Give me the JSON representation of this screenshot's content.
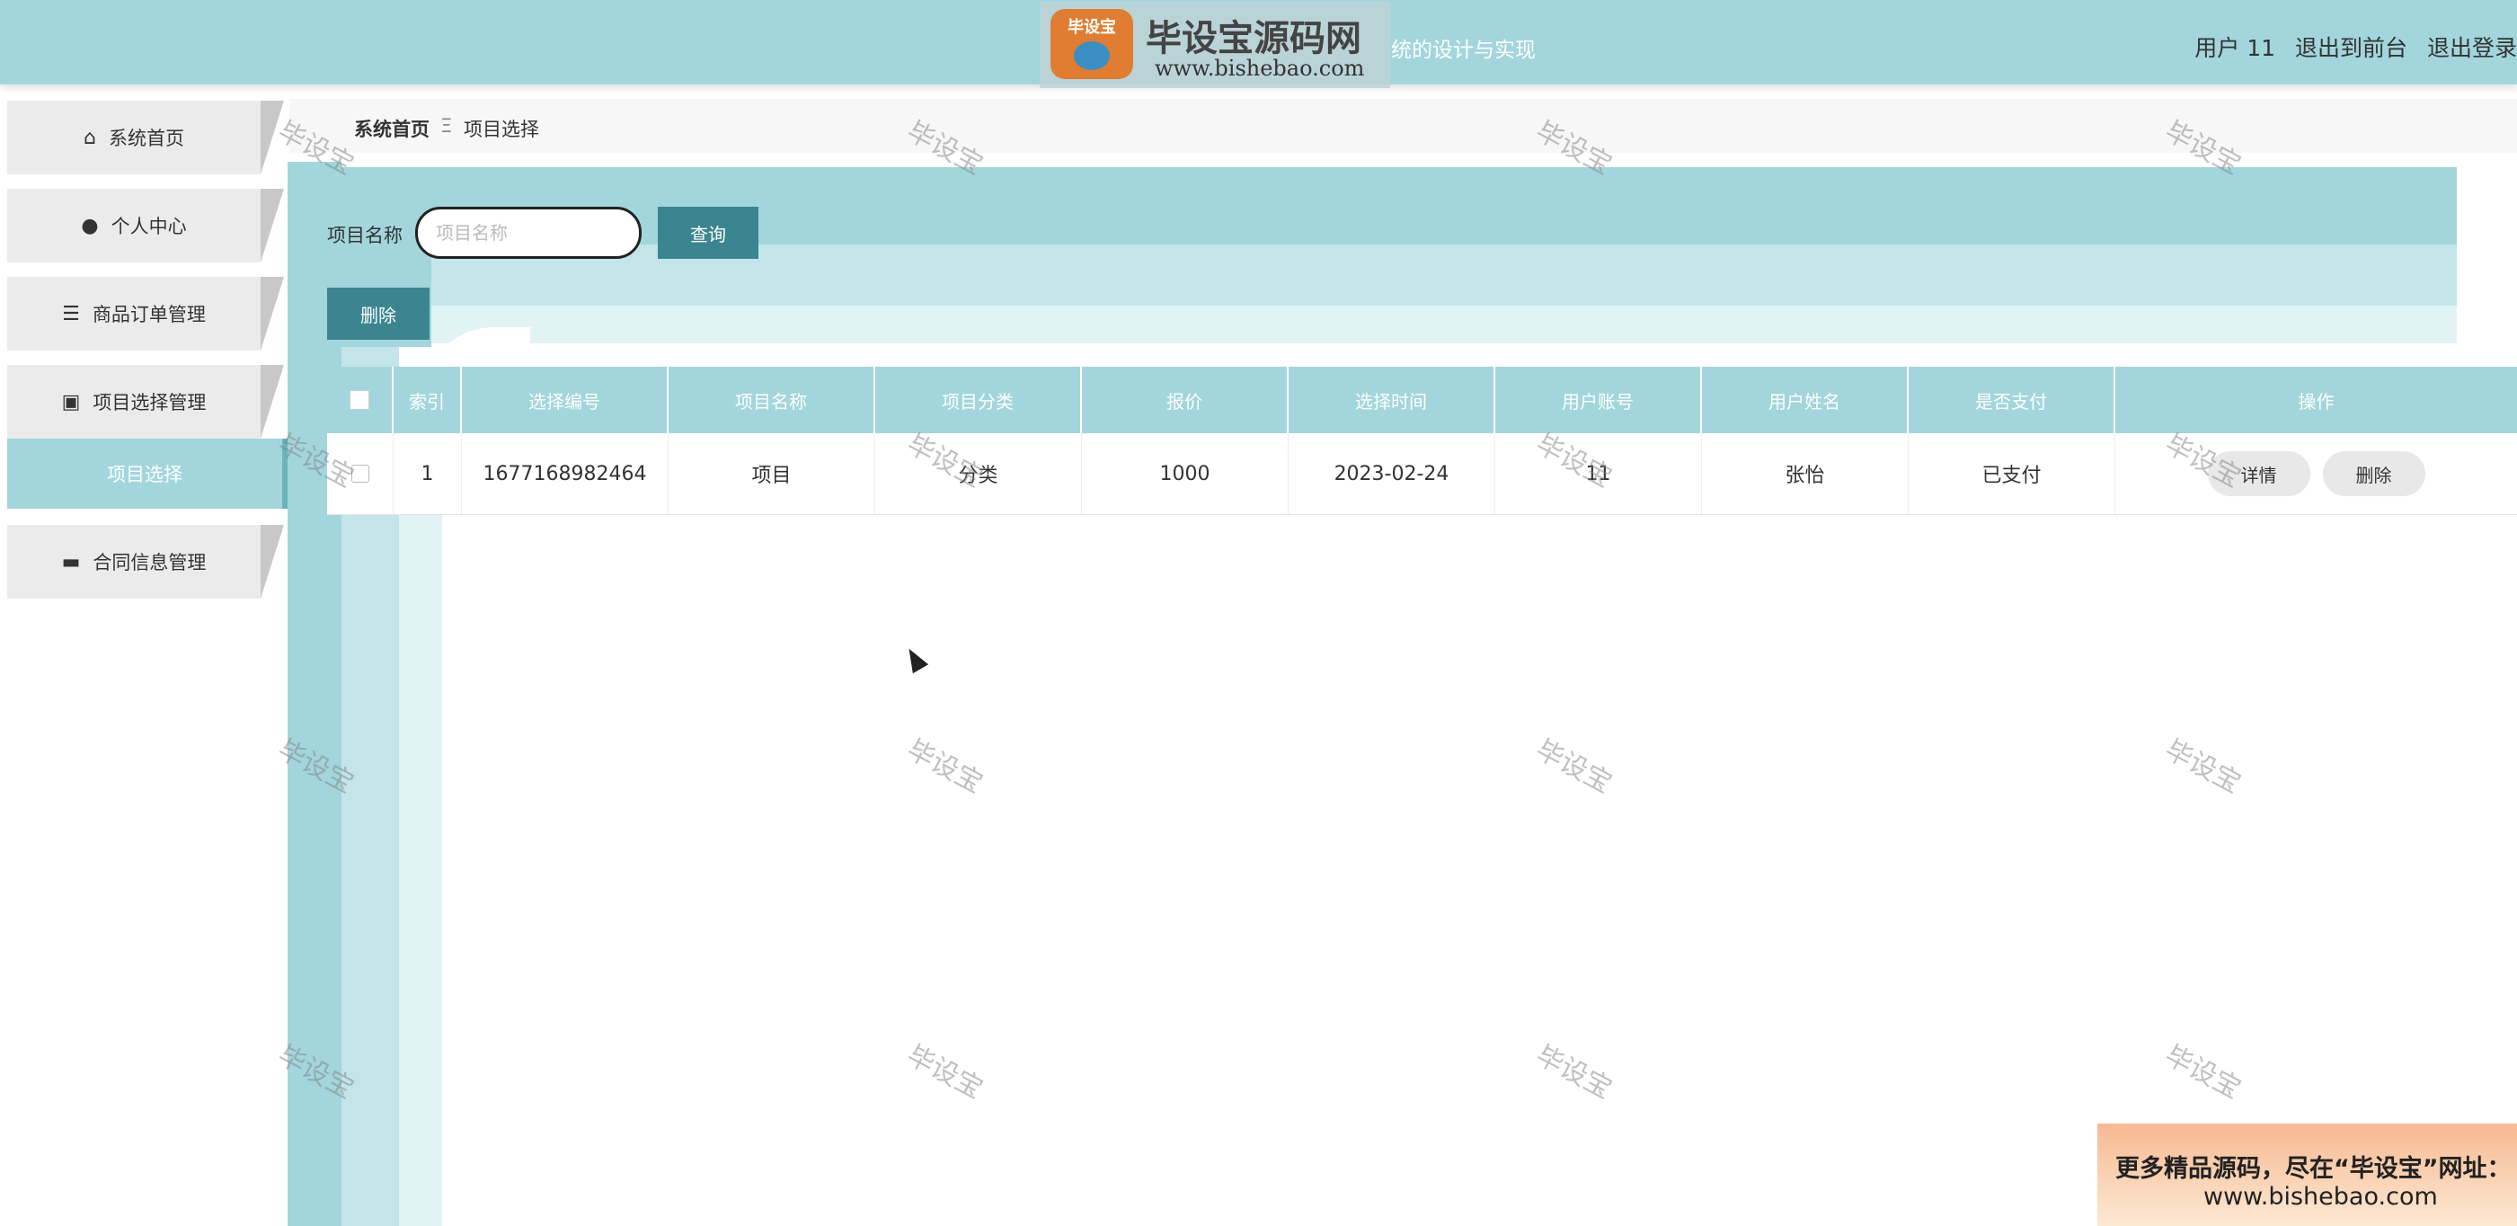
{
  "header": {
    "logo_title": "毕设宝源码网",
    "logo_url": "www.bishebao.com",
    "logo_badge": "毕设宝",
    "app_title_partial": "统的设计与实现",
    "user_label": "用户 11",
    "back_to_front": "退出到前台",
    "logout": "退出登录"
  },
  "sidebar": {
    "items": [
      {
        "label": "系统首页",
        "icon": "home-icon"
      },
      {
        "label": "个人中心",
        "icon": "user-icon"
      },
      {
        "label": "商品订单管理",
        "icon": "list-icon"
      },
      {
        "label": "项目选择管理",
        "icon": "clipboard-icon"
      },
      {
        "label": "合同信息管理",
        "icon": "archive-icon"
      }
    ],
    "active_sub": "项目选择"
  },
  "breadcrumb": {
    "home": "系统首页",
    "separator": "Ξ",
    "current": "项目选择"
  },
  "search": {
    "label": "项目名称",
    "placeholder": "项目名称",
    "query_button": "查询",
    "delete_button": "删除"
  },
  "table": {
    "columns": [
      "索引",
      "选择编号",
      "项目名称",
      "项目分类",
      "报价",
      "选择时间",
      "用户账号",
      "用户姓名",
      "是否支付",
      "操作"
    ],
    "rows": [
      {
        "index": "1",
        "select_no": "1677168982464",
        "project_name": "项目",
        "category": "分类",
        "price": "1000",
        "select_time": "2023-02-24",
        "account": "11",
        "user_name": "张怡",
        "paid": "已支付",
        "detail_button": "详情",
        "delete_button": "删除"
      }
    ]
  },
  "watermark": "毕设宝",
  "promo": {
    "line1": "更多精品源码，尽在“毕设宝”网址：",
    "line2": "www.bishebao.com"
  },
  "colors": {
    "primary": "#a2d6dc",
    "button": "#3b8590"
  }
}
